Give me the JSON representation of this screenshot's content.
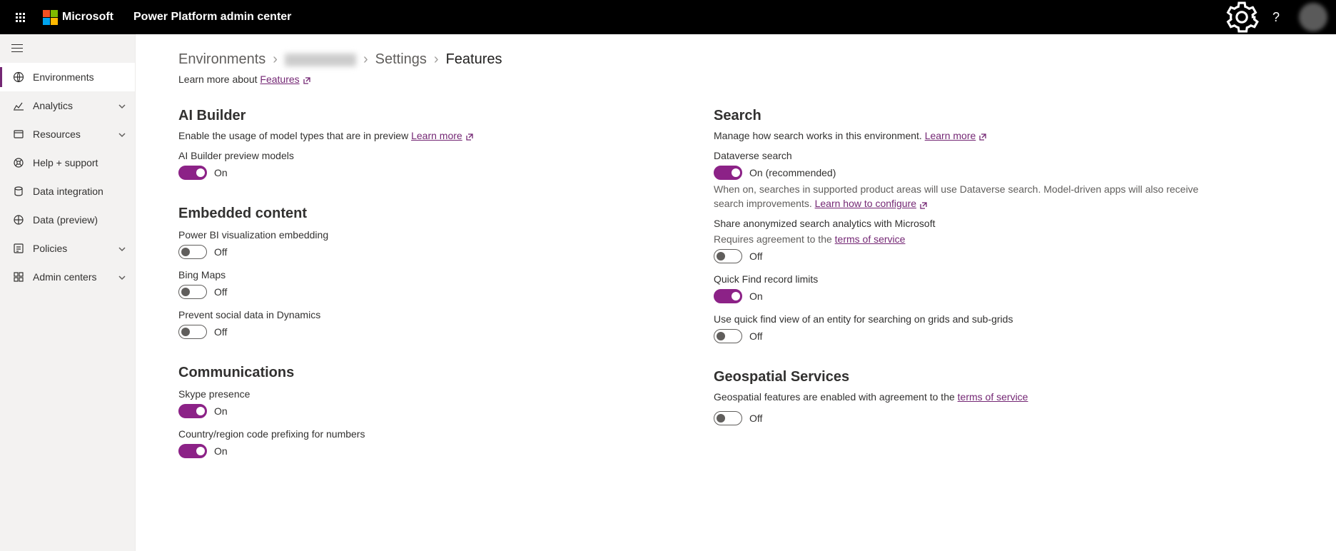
{
  "header": {
    "brand": "Microsoft",
    "product": "Power Platform admin center"
  },
  "sidebar": {
    "items": [
      {
        "label": "Environments",
        "active": true,
        "expandable": false
      },
      {
        "label": "Analytics",
        "active": false,
        "expandable": true
      },
      {
        "label": "Resources",
        "active": false,
        "expandable": true
      },
      {
        "label": "Help + support",
        "active": false,
        "expandable": false
      },
      {
        "label": "Data integration",
        "active": false,
        "expandable": false
      },
      {
        "label": "Data (preview)",
        "active": false,
        "expandable": false
      },
      {
        "label": "Policies",
        "active": false,
        "expandable": true
      },
      {
        "label": "Admin centers",
        "active": false,
        "expandable": true
      }
    ]
  },
  "breadcrumb": {
    "root": "Environments",
    "settings": "Settings",
    "current": "Features"
  },
  "learn": {
    "prefix": "Learn more about ",
    "link_text": "Features"
  },
  "left_col": {
    "ai_builder": {
      "heading": "AI Builder",
      "desc_prefix": "Enable the usage of model types that are in preview ",
      "learn_more": "Learn more",
      "field1_label": "AI Builder preview models",
      "field1_state": "On"
    },
    "embedded": {
      "heading": "Embedded content",
      "powerbi_label": "Power BI visualization embedding",
      "powerbi_state": "Off",
      "bing_label": "Bing Maps",
      "bing_state": "Off",
      "social_label": "Prevent social data in Dynamics",
      "social_state": "Off"
    },
    "comm": {
      "heading": "Communications",
      "skype_label": "Skype presence",
      "skype_state": "On",
      "country_label": "Country/region code prefixing for numbers",
      "country_state": "On"
    }
  },
  "right_col": {
    "search": {
      "heading": "Search",
      "desc_prefix": "Manage how search works in this environment. ",
      "learn_more": "Learn more",
      "dataverse_label": "Dataverse search",
      "dataverse_state": "On (recommended)",
      "dataverse_help_prefix": "When on, searches in supported product areas will use Dataverse search. Model-driven apps will also receive search improvements. ",
      "dataverse_help_link": "Learn how to configure",
      "anon_label": "Share anonymized search analytics with Microsoft",
      "anon_sub_prefix": "Requires agreement to the ",
      "anon_sub_link": "terms of service",
      "anon_state": "Off",
      "quickfind_label": "Quick Find record limits",
      "quickfind_state": "On",
      "quickview_label": "Use quick find view of an entity for searching on grids and sub-grids",
      "quickview_state": "Off"
    },
    "geo": {
      "heading": "Geospatial Services",
      "desc_prefix": "Geospatial features are enabled with agreement to the ",
      "desc_link": "terms of service",
      "state": "Off"
    }
  }
}
